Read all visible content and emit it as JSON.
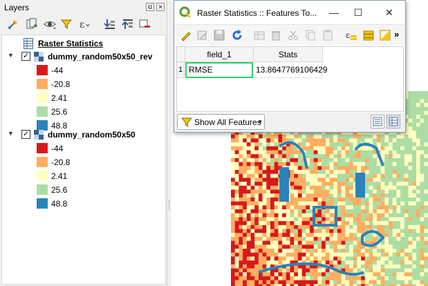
{
  "layers_panel": {
    "title": "Layers",
    "dock_float_glyph": "⧉",
    "dock_close_glyph": "✕",
    "toolbar_icons": [
      "style-manager-icon",
      "add-group-icon",
      "visibility-eye-icon",
      "filter-funnel-icon",
      "epsilon-filter-icon",
      "expand-all-icon",
      "collapse-all-icon",
      "remove-layer-icon"
    ],
    "group": {
      "name": "Raster Statistics"
    },
    "layers": [
      {
        "name": "dummy_random50x50_rev",
        "checked": "✓",
        "expander": "▼",
        "legend": [
          {
            "label": "-44",
            "color": "#d7191c"
          },
          {
            "label": "-20.8",
            "color": "#fdae61"
          },
          {
            "label": "2.41",
            "color": "#ffffbf"
          },
          {
            "label": "25.6",
            "color": "#abdda4"
          },
          {
            "label": "48.8",
            "color": "#2b83ba"
          }
        ]
      },
      {
        "name": "dummy_random50x50",
        "checked": "✓",
        "expander": "▼",
        "legend": [
          {
            "label": "-44",
            "color": "#d7191c"
          },
          {
            "label": "-20.8",
            "color": "#fdae61"
          },
          {
            "label": "2.41",
            "color": "#ffffbf"
          },
          {
            "label": "25.6",
            "color": "#abdda4"
          },
          {
            "label": "48.8",
            "color": "#2b83ba"
          }
        ]
      }
    ]
  },
  "attribute_window": {
    "title": "Raster Statistics :: Features To...",
    "minimize_glyph": "—",
    "maximize_glyph": "☐",
    "close_glyph": "✕",
    "overflow_glyph": "»",
    "toolbar_icons": [
      "toggle-editing-icon",
      "multi-edit-icon",
      "save-edits-icon",
      "reload-icon",
      "add-feature-icon",
      "delete-feature-icon",
      "cut-icon",
      "copy-icon",
      "paste-icon",
      "expression-select-icon",
      "select-all-icon",
      "invert-selection-icon"
    ],
    "columns": [
      "field_1",
      "Stats"
    ],
    "rows": [
      {
        "row_number": "1",
        "field_1": "RMSE",
        "stats": "13.8647769106429"
      }
    ],
    "show_all_features": "Show All Features",
    "dropdown_glyph": "▾"
  },
  "colors": {
    "accent_green": "#33cc66",
    "qgis_green": "#589632",
    "qgis_yellow": "#f0c419",
    "raster_red": "#d7191c",
    "raster_orange": "#fdae61",
    "raster_yellow": "#ffffbf",
    "raster_green": "#abdda4",
    "raster_blue": "#2b83ba"
  }
}
